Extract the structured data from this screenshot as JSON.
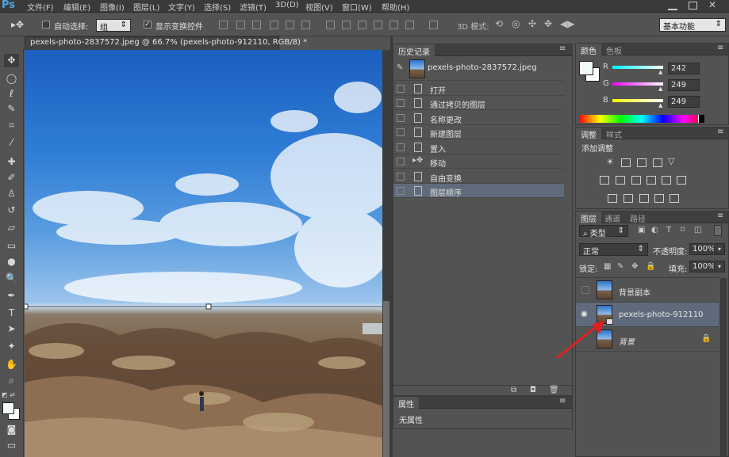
{
  "app": {
    "logo": "Ps"
  },
  "menu": [
    "文件(F)",
    "编辑(E)",
    "图像(I)",
    "图层(L)",
    "文字(Y)",
    "选择(S)",
    "滤镜(T)",
    "3D(D)",
    "视图(V)",
    "窗口(W)",
    "帮助(H)"
  ],
  "options": {
    "auto_select_label": "自动选择:",
    "auto_select_value": "组",
    "show_transform_label": "显示变换控件",
    "mode_3d_label": "3D 模式:",
    "workspace": "基本功能"
  },
  "document": {
    "tab_title": "pexels-photo-2837572.jpeg @ 66.7% (pexels-photo-912110, RGB/8) *"
  },
  "history": {
    "tab": "历史记录",
    "snapshot": "pexels-photo-2837572.jpeg",
    "items": [
      "打开",
      "通过拷贝的图层",
      "名称更改",
      "新建图层",
      "置入",
      "移动",
      "自由变换",
      "图层顺序"
    ],
    "selected_index": 7
  },
  "properties": {
    "tab": "属性",
    "empty_text": "无属性"
  },
  "color": {
    "tabs": [
      "颜色",
      "色板"
    ],
    "channels": [
      {
        "label": "R",
        "value": "242",
        "color": "#00e5ff"
      },
      {
        "label": "G",
        "value": "249",
        "color": "#ff00ff"
      },
      {
        "label": "B",
        "value": "249",
        "color": "#ffff00"
      }
    ]
  },
  "adjustments": {
    "tabs": [
      "调整",
      "样式"
    ],
    "add_label": "添加调整"
  },
  "layers": {
    "tabs": [
      "图层",
      "通道",
      "路径"
    ],
    "filter_label": "类型",
    "blend_mode": "正常",
    "opacity_label": "不透明度:",
    "opacity_value": "100%",
    "lock_label": "锁定:",
    "fill_label": "填充:",
    "fill_value": "100%",
    "items": [
      {
        "name": "背景副本",
        "visible": false,
        "selected": false
      },
      {
        "name": "pexels-photo-912110",
        "visible": true,
        "selected": true
      },
      {
        "name": "背景",
        "visible": false,
        "selected": false
      }
    ]
  },
  "accent": {
    "arrow": "#e02020",
    "selection": "#5f6b7a"
  }
}
